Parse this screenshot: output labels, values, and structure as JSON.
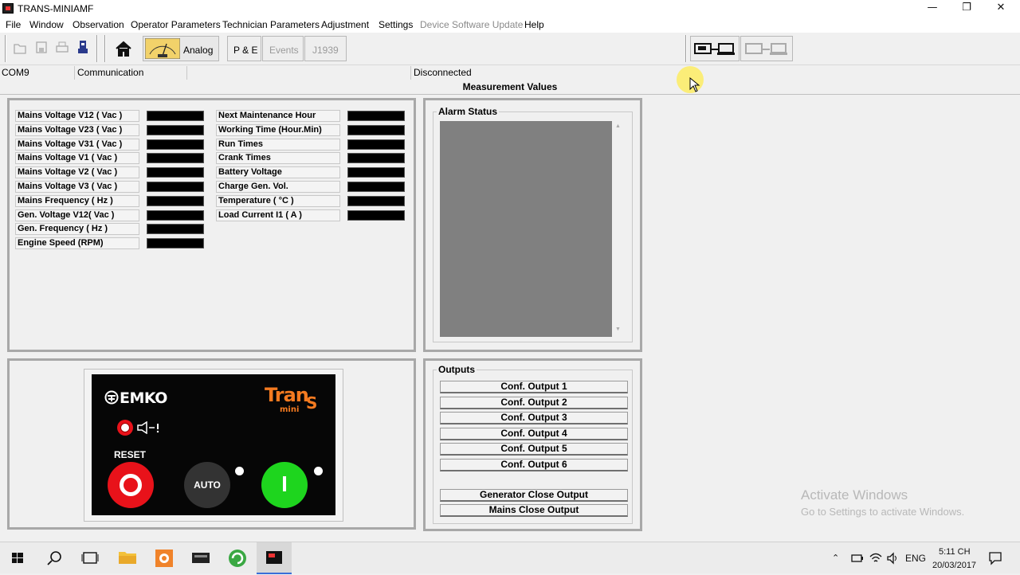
{
  "window": {
    "title": "TRANS-MINIAMF",
    "minimize": "—",
    "restore": "❐",
    "close": "✕"
  },
  "menu": [
    {
      "label": "File",
      "enabled": true
    },
    {
      "label": "Window",
      "enabled": true
    },
    {
      "label": "Observation",
      "enabled": true
    },
    {
      "label": "Operator Parameters",
      "enabled": true
    },
    {
      "label": "Technician Parameters",
      "enabled": true
    },
    {
      "label": "Adjustment",
      "enabled": true
    },
    {
      "label": "Settings",
      "enabled": true
    },
    {
      "label": "Device Software Update",
      "enabled": false
    },
    {
      "label": "Help",
      "enabled": true
    }
  ],
  "toolbar": {
    "analog": "Analog",
    "pe": "P & E",
    "events": "Events",
    "j1939": "J1939"
  },
  "status": {
    "port": "COM9",
    "comm": "Communication",
    "blank": "",
    "connection": "Disconnected"
  },
  "measurement": {
    "title": "Measurement Values",
    "left": [
      "Mains Voltage V12 ( Vac )",
      "Mains Voltage V23 ( Vac )",
      "Mains Voltage V31 ( Vac )",
      "Mains Voltage V1 ( Vac )",
      "Mains Voltage V2 ( Vac )",
      "Mains Voltage V3 ( Vac )",
      "Mains Frequency ( Hz )",
      "Gen. Voltage V12( Vac )",
      "Gen. Frequency ( Hz )",
      "Engine Speed (RPM)"
    ],
    "right": [
      "Next Maintenance Hour",
      "Working Time (Hour.Min)",
      "Run Times",
      "Crank Times",
      "Battery Voltage",
      "Charge Gen. Vol.",
      "Temperature ( °C )",
      "Load Current I1 ( A )"
    ]
  },
  "alarm": {
    "title": "Alarm Status",
    "scroll_up": "▲",
    "scroll_down": "▼"
  },
  "outputs": {
    "title": "Outputs",
    "buttons": [
      "Conf. Output 1",
      "Conf. Output 2",
      "Conf. Output 3",
      "Conf. Output 4",
      "Conf. Output 5",
      "Conf. Output 6"
    ],
    "generator_close": "Generator Close Output",
    "mains_close": "Mains Close Output"
  },
  "device": {
    "brand": "EMKO",
    "logo": "Tran",
    "logo_s": "S",
    "logo_mini": "mini",
    "reset": "RESET",
    "auto": "AUTO",
    "on_symbol": "I"
  },
  "watermark": {
    "line1": "Activate Windows",
    "line2": "Go to Settings to activate Windows."
  },
  "tray": {
    "lang": "ENG",
    "time": "5:11 CH",
    "date": "20/03/2017"
  },
  "colors": {
    "accent_red": "#e8121a",
    "accent_green": "#1ed51e",
    "logo_orange": "#f47a20"
  }
}
